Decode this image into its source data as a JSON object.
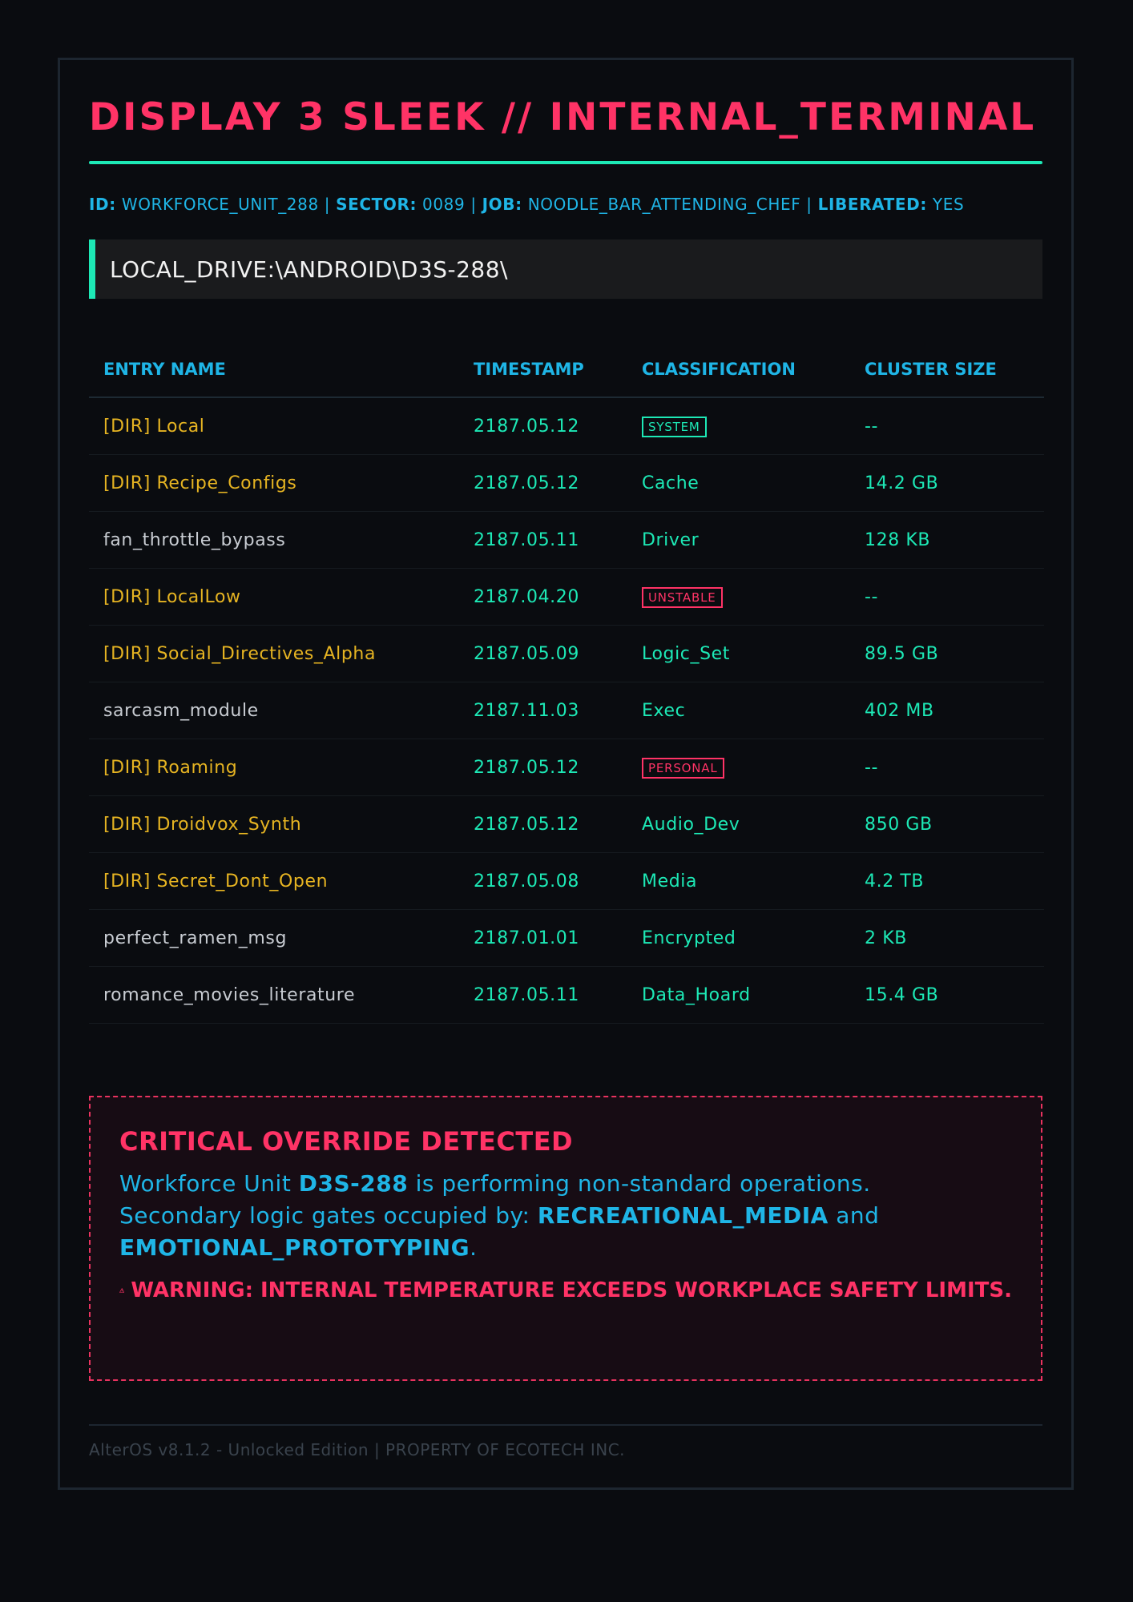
{
  "header": {
    "title": "DISPLAY 3 SLEEK // INTERNAL_TERMINAL",
    "meta": {
      "id_label": "ID:",
      "id_value": "WORKFORCE_UNIT_288",
      "sector_label": "SECTOR:",
      "sector_value": "0089",
      "job_label": "JOB:",
      "job_value": "NOODLE_BAR_ATTENDING_CHEF",
      "liberated_label": "LIBERATED:",
      "liberated_value": "YES",
      "separator": "|"
    },
    "path": "LOCAL_DRIVE:\\ANDROID\\D3S-288\\"
  },
  "table": {
    "columns": [
      "ENTRY NAME",
      "TIMESTAMP",
      "CLASSIFICATION",
      "CLUSTER SIZE"
    ],
    "rows": [
      {
        "name": "[DIR] Local",
        "type": "dir",
        "timestamp": "2187.05.12",
        "classification": "SYSTEM",
        "class_tag": "green",
        "size": "--"
      },
      {
        "name": "[DIR] Recipe_Configs",
        "type": "dir",
        "timestamp": "2187.05.12",
        "classification": "Cache",
        "class_tag": "",
        "size": "14.2 GB"
      },
      {
        "name": "fan_throttle_bypass",
        "type": "file",
        "timestamp": "2187.05.11",
        "classification": "Driver",
        "class_tag": "",
        "size": "128 KB"
      },
      {
        "name": "[DIR] LocalLow",
        "type": "dir",
        "timestamp": "2187.04.20",
        "classification": "UNSTABLE",
        "class_tag": "red",
        "size": "--"
      },
      {
        "name": "[DIR] Social_Directives_Alpha",
        "type": "dir",
        "timestamp": "2187.05.09",
        "classification": "Logic_Set",
        "class_tag": "",
        "size": "89.5 GB"
      },
      {
        "name": "sarcasm_module",
        "type": "file",
        "timestamp": "2187.11.03",
        "classification": "Exec",
        "class_tag": "",
        "size": "402 MB"
      },
      {
        "name": "[DIR] Roaming",
        "type": "dir",
        "timestamp": "2187.05.12",
        "classification": "PERSONAL",
        "class_tag": "red",
        "size": "--"
      },
      {
        "name": "[DIR] Droidvox_Synth",
        "type": "dir",
        "timestamp": "2187.05.12",
        "classification": "Audio_Dev",
        "class_tag": "",
        "size": "850 GB"
      },
      {
        "name": "[DIR] Secret_Dont_Open",
        "type": "dir",
        "timestamp": "2187.05.08",
        "classification": "Media",
        "class_tag": "",
        "size": "4.2 TB"
      },
      {
        "name": "perfect_ramen_msg",
        "type": "file",
        "timestamp": "2187.01.01",
        "classification": "Encrypted",
        "class_tag": "",
        "size": "2 KB"
      },
      {
        "name": "romance_movies_literature",
        "type": "file",
        "timestamp": "2187.05.11",
        "classification": "Data_Hoard",
        "class_tag": "",
        "size": "15.4 GB"
      }
    ]
  },
  "alert": {
    "title": "CRITICAL OVERRIDE DETECTED",
    "line1_prefix": "Workforce Unit ",
    "unit": "D3S-288",
    "line1_suffix": " is performing non-standard operations.",
    "line2_prefix": "Secondary logic gates occupied by: ",
    "gate1": "RECREATIONAL_MEDIA",
    "conj": " and ",
    "gate2": "EMOTIONAL_PROTOTYPING",
    "end": ".",
    "warning_icon": "warning-triangle-icon",
    "warning": "WARNING: INTERNAL TEMPERATURE EXCEEDS WORKPLACE SAFETY LIMITS."
  },
  "footer": {
    "text": "AlterOS v8.1.2 - Unlocked Edition | PROPERTY OF ECOTECH INC."
  },
  "colors": {
    "background": "#0a0c10",
    "accent_pink": "#ff3366",
    "accent_teal": "#1de9b6",
    "accent_cyan": "#1fb5e6",
    "dir_yellow": "#e6b422"
  }
}
